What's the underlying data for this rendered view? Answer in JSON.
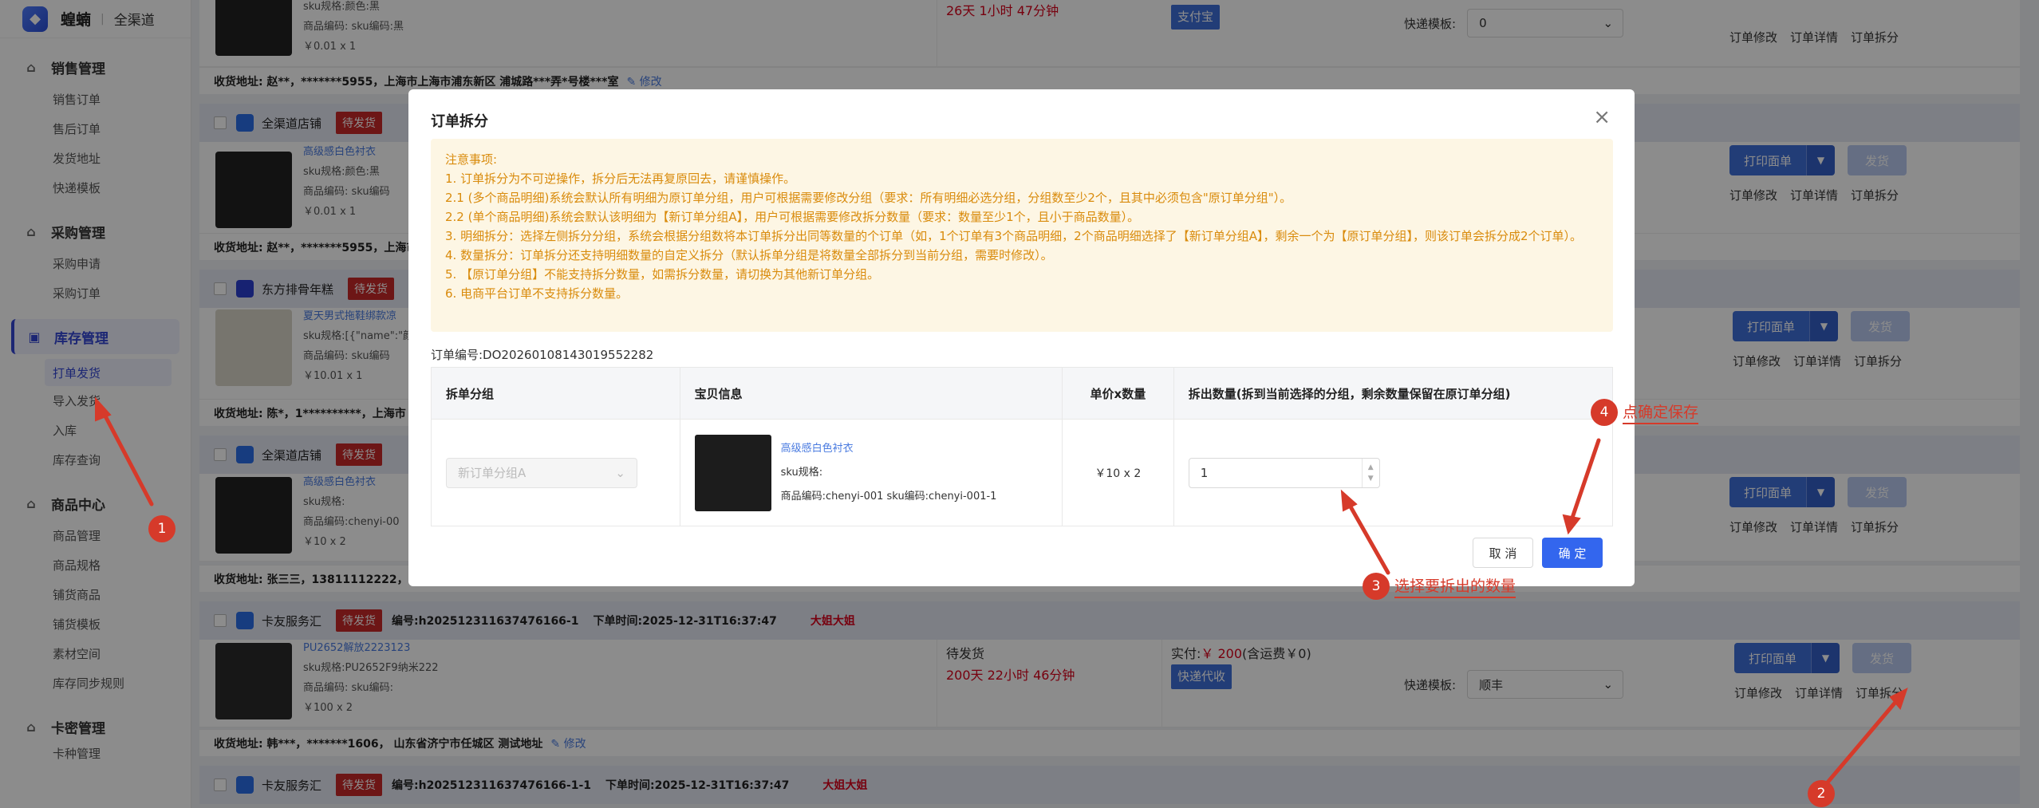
{
  "app": {
    "logo_text": "蝗蝻",
    "logo_sub": "全渠道"
  },
  "sidebar": {
    "groups": [
      {
        "title": "销售管理",
        "items": [
          "销售订单",
          "售后订单",
          "发货地址",
          "快递模板"
        ]
      },
      {
        "title": "采购管理",
        "items": [
          "采购申请",
          "采购订单"
        ]
      },
      {
        "title": "库存管理",
        "items": [
          "打单发货",
          "导入发货",
          "入库",
          "库存查询"
        ]
      },
      {
        "title": "商品中心",
        "items": [
          "商品管理",
          "商品规格",
          "铺货商品",
          "铺货模板",
          "素材空间",
          "库存同步规则"
        ]
      },
      {
        "title": "卡密管理",
        "items": [
          "卡种管理"
        ]
      }
    ]
  },
  "orders": {
    "o1": {
      "sku_color": "sku规格:颜色:黑",
      "code": "商品编码:   sku编码:黑",
      "price": "￥0.01 x 1",
      "countdown": "26天 1小时 47分钟",
      "pay_badge": "支付宝",
      "tpl_label": "快递模板:",
      "tpl_value": "0",
      "ops": [
        "订单修改",
        "订单详情",
        "订单拆分"
      ],
      "address": "收货地址: 赵**，*******5955，上海市上海市浦东新区 浦城路***弄*号楼***室",
      "edit": "修改"
    },
    "o2": {
      "shop": "全渠道店铺",
      "status": "待发货",
      "title": "高级感白色衬衣",
      "sku": "sku规格:颜色:黑",
      "code": "商品编码:   sku编码",
      "price": "￥0.01 x 1",
      "print": "打印面单",
      "ship": "发货",
      "ops": [
        "订单修改",
        "订单详情",
        "订单拆分"
      ],
      "address": "收货地址: 赵**，*******5955，上海市"
    },
    "o3": {
      "shop": "东方排骨年糕",
      "status": "待发货",
      "title": "夏天男式拖鞋绑款凉",
      "sku": "sku规格:[{\"name\":\"颜",
      "code": "商品编码:   sku编码",
      "price": "￥10.01 x 1",
      "print": "打印面单",
      "ship": "发货",
      "ops": [
        "订单修改",
        "订单详情",
        "订单拆分"
      ],
      "address": "收货地址: 陈*，1**********，上海市"
    },
    "o4": {
      "shop": "全渠道店铺",
      "status": "待发货",
      "title": "高级感白色衬衣",
      "sku": "sku规格:",
      "code": "商品编码:chenyi-00",
      "price": "￥10 x 2",
      "print": "打印面单",
      "ship": "发货",
      "ops": [
        "订单修改",
        "订单详情",
        "订单拆分"
      ],
      "address": "收货地址: 张三三，13811112222，"
    },
    "o5": {
      "shop": "卡友服务汇",
      "status": "待发货",
      "order_no": "编号:h202512311637476166-1",
      "order_time": "下单时间:2025-12-31T16:37:47",
      "tag": "大姐大姐",
      "title": "PU2652解放2223123",
      "sku": "sku规格:PU2652F9纳米222",
      "code": "商品编码:   sku编码:",
      "price": "￥100 x 2",
      "ship_status": "待发货",
      "countdown": "200天 22小时 46分钟",
      "paid": "实付:",
      "paid_amount": "￥ 200",
      "paid_rest": "(含运费￥0)",
      "pay_badge": "快递代收",
      "tpl_label": "快递模板:",
      "tpl_value": "顺丰",
      "print": "打印面单",
      "ship": "发货",
      "ops": [
        "订单修改",
        "订单详情",
        "订单拆分"
      ],
      "address": "收货地址: 韩***，*******1606，  山东省济宁市任城区 测试地址",
      "edit": "修改"
    },
    "o6": {
      "shop": "卡友服务汇",
      "status": "待发货",
      "order_no": "编号:h202512311637476166-1-1",
      "order_time": "下单时间:2025-12-31T16:37:47",
      "tag": "大姐大姐"
    }
  },
  "modal": {
    "title": "订单拆分",
    "notice": [
      "注意事项:",
      "1. 订单拆分为不可逆操作，拆分后无法再复原回去，请谨慎操作。",
      "2.1 (多个商品明细)系统会默认所有明细为原订单分组，用户可根据需要修改分组（要求：所有明细必选分组，分组数至少2个，且其中必须包含\"原订单分组\"）。",
      "2.2 (单个商品明细)系统会默认该明细为【新订单分组A】，用户可根据需要修改拆分数量（要求：数量至少1个，且小于商品数量）。",
      "3. 明细拆分：选择左侧拆分分组，系统会根据分组数将本订单拆分出同等数量的个订单（如，1个订单有3个商品明细，2个商品明细选择了【新订单分组A】，剩余一个为【原订单分组】，则该订单会拆分成2个订单）。",
      "4. 数量拆分：订单拆分还支持明细数量的自定义拆分（默认拆单分组是将数量全部拆分到当前分组，需要时修改）。",
      "5. 【原订单分组】不能支持拆分数量，如需拆分数量，请切换为其他新订单分组。",
      "6. 电商平台订单不支持拆分数量。"
    ],
    "order_code": "订单编号:DO20260108143019552282",
    "columns": [
      "拆单分组",
      "宝贝信息",
      "单价x数量",
      "拆出数量(拆到当前选择的分组，剩余数量保留在原订单分组)"
    ],
    "row": {
      "group_value": "新订单分组A",
      "goods_title": "高级感白色衬衣",
      "goods_sku": "sku规格:",
      "goods_code": "商品编码:chenyi-001    sku编码:chenyi-001-1",
      "unit_qty": "￥10 x 2",
      "split_qty": "1"
    },
    "cancel": "取 消",
    "ok": "确 定"
  },
  "annotations": {
    "step1": "1",
    "step2": "2",
    "step3": "3",
    "step4": "4",
    "label3": "选择要拆出的数量",
    "label4": "点确定保存",
    "color": "#d63a2a"
  }
}
